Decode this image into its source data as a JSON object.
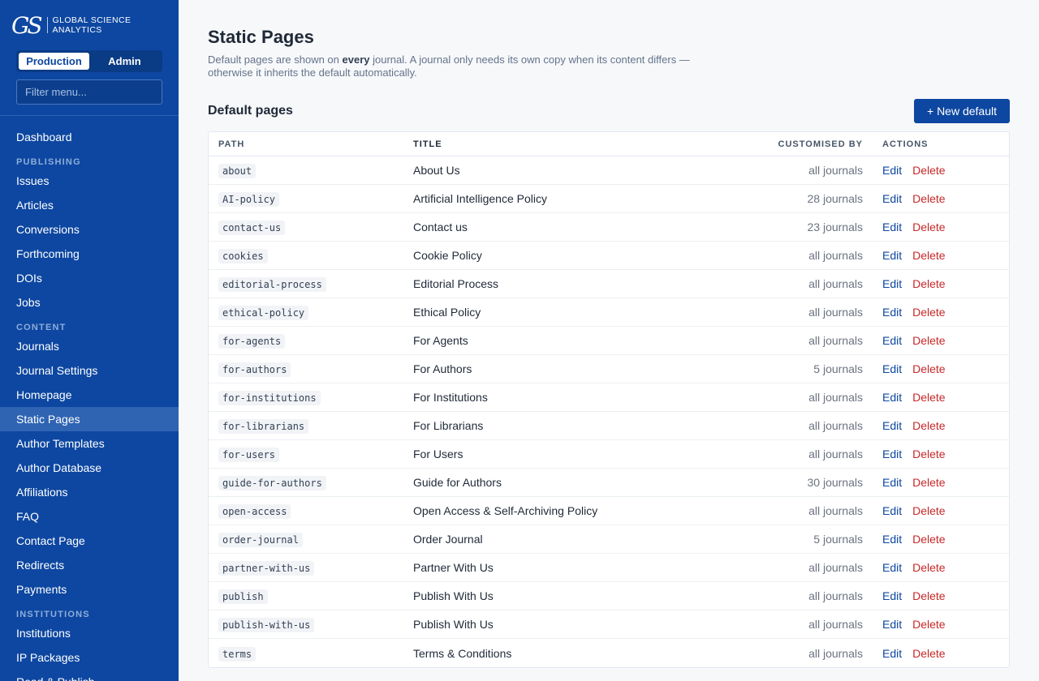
{
  "brand": {
    "mark": "GS",
    "name": "GLOBAL SCIENCE ANALYTICS"
  },
  "env_toggle": {
    "production": "Production",
    "admin": "Admin"
  },
  "filter": {
    "placeholder": "Filter menu..."
  },
  "nav": {
    "dashboard": "Dashboard",
    "publishing_label": "PUBLISHING",
    "issues": "Issues",
    "articles": "Articles",
    "conversions": "Conversions",
    "forthcoming": "Forthcoming",
    "dois": "DOIs",
    "jobs": "Jobs",
    "content_label": "CONTENT",
    "journals": "Journals",
    "journal_settings": "Journal Settings",
    "homepage": "Homepage",
    "static_pages": "Static Pages",
    "author_templates": "Author Templates",
    "author_database": "Author Database",
    "affiliations": "Affiliations",
    "faq": "FAQ",
    "contact_page": "Contact Page",
    "redirects": "Redirects",
    "payments": "Payments",
    "institutions_label": "INSTITUTIONS",
    "institutions": "Institutions",
    "ip_packages": "IP Packages",
    "read_publish": "Read & Publish"
  },
  "page": {
    "title": "Static Pages",
    "intro_before": "Default pages are shown on ",
    "intro_bold": "every",
    "intro_after": " journal. A journal only needs its own copy when its content differs — otherwise it inherits the default automatically."
  },
  "section": {
    "title": "Default pages",
    "new_button": "+ New default"
  },
  "table": {
    "headers": {
      "path": "PATH",
      "title": "TITLE",
      "customised": "CUSTOMISED BY",
      "actions": "ACTIONS"
    },
    "edit_label": "Edit",
    "delete_label": "Delete",
    "rows": [
      {
        "path": "about",
        "title": "About Us",
        "customised": "all journals"
      },
      {
        "path": "AI-policy",
        "title": "Artificial Intelligence Policy",
        "customised": "28 journals"
      },
      {
        "path": "contact-us",
        "title": "Contact us",
        "customised": "23 journals"
      },
      {
        "path": "cookies",
        "title": "Cookie Policy",
        "customised": "all journals"
      },
      {
        "path": "editorial-process",
        "title": "Editorial Process",
        "customised": "all journals"
      },
      {
        "path": "ethical-policy",
        "title": "Ethical Policy",
        "customised": "all journals"
      },
      {
        "path": "for-agents",
        "title": "For Agents",
        "customised": "all journals"
      },
      {
        "path": "for-authors",
        "title": "For Authors",
        "customised": "5 journals"
      },
      {
        "path": "for-institutions",
        "title": "For Institutions",
        "customised": "all journals"
      },
      {
        "path": "for-librarians",
        "title": "For Librarians",
        "customised": "all journals"
      },
      {
        "path": "for-users",
        "title": "For Users",
        "customised": "all journals"
      },
      {
        "path": "guide-for-authors",
        "title": "Guide for Authors",
        "customised": "30 journals"
      },
      {
        "path": "open-access",
        "title": "Open Access & Self-Archiving Policy",
        "customised": "all journals"
      },
      {
        "path": "order-journal",
        "title": "Order Journal",
        "customised": "5 journals"
      },
      {
        "path": "partner-with-us",
        "title": "Partner With Us",
        "customised": "all journals"
      },
      {
        "path": "publish",
        "title": "Publish With Us",
        "customised": "all journals"
      },
      {
        "path": "publish-with-us",
        "title": "Publish With Us",
        "customised": "all journals"
      },
      {
        "path": "terms",
        "title": "Terms & Conditions",
        "customised": "all journals"
      }
    ]
  }
}
